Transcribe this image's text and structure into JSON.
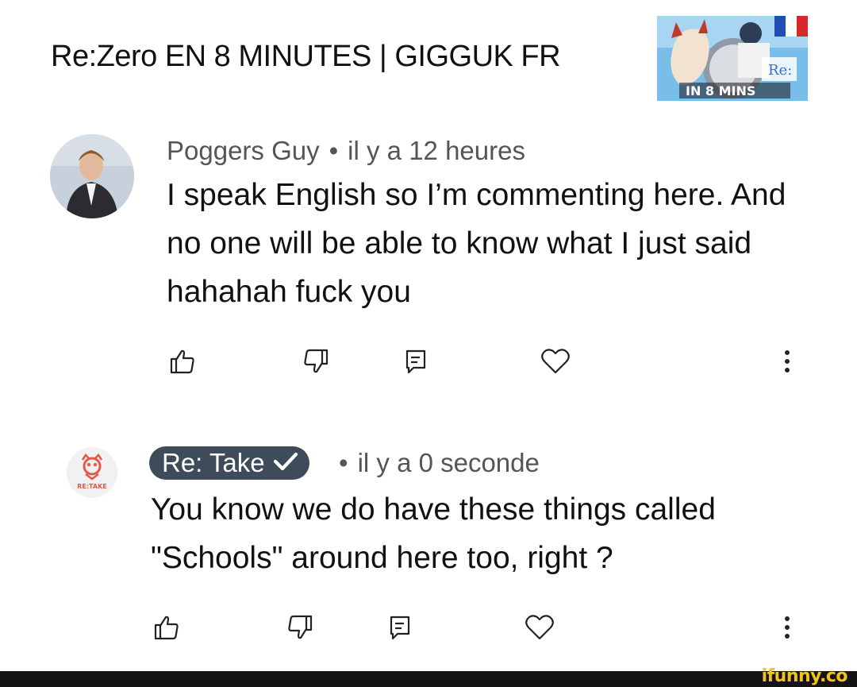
{
  "video": {
    "title": "Re:Zero EN 8 MINUTES | GIGGUK FR",
    "thumbnail_text": "IN 8 MINS"
  },
  "comments": [
    {
      "author": "Poggers Guy",
      "separator": "•",
      "time": "il y a 12 heures",
      "text": "I speak English so I’m commenting here. And no one will be able to know what I just said hahahah fuck you",
      "actions": [
        "like-icon",
        "dislike-icon",
        "reply-icon",
        "heart-icon",
        "more-icon"
      ]
    },
    {
      "author": "Re: Take",
      "verified": true,
      "avatar_text": "RE:TAKE",
      "separator": "•",
      "time": "il y a 0 seconde",
      "text": "You know we do have these things called \"Schools\" around here too, right ?",
      "actions": [
        "like-icon",
        "dislike-icon",
        "reply-icon",
        "heart-icon",
        "more-icon"
      ]
    }
  ],
  "watermark": "ifunny.co",
  "colors": {
    "badge_bg": "#3e4b5b",
    "meta_text": "#555555",
    "brand_yellow": "#f4c21c",
    "footer_bg": "#141414"
  }
}
